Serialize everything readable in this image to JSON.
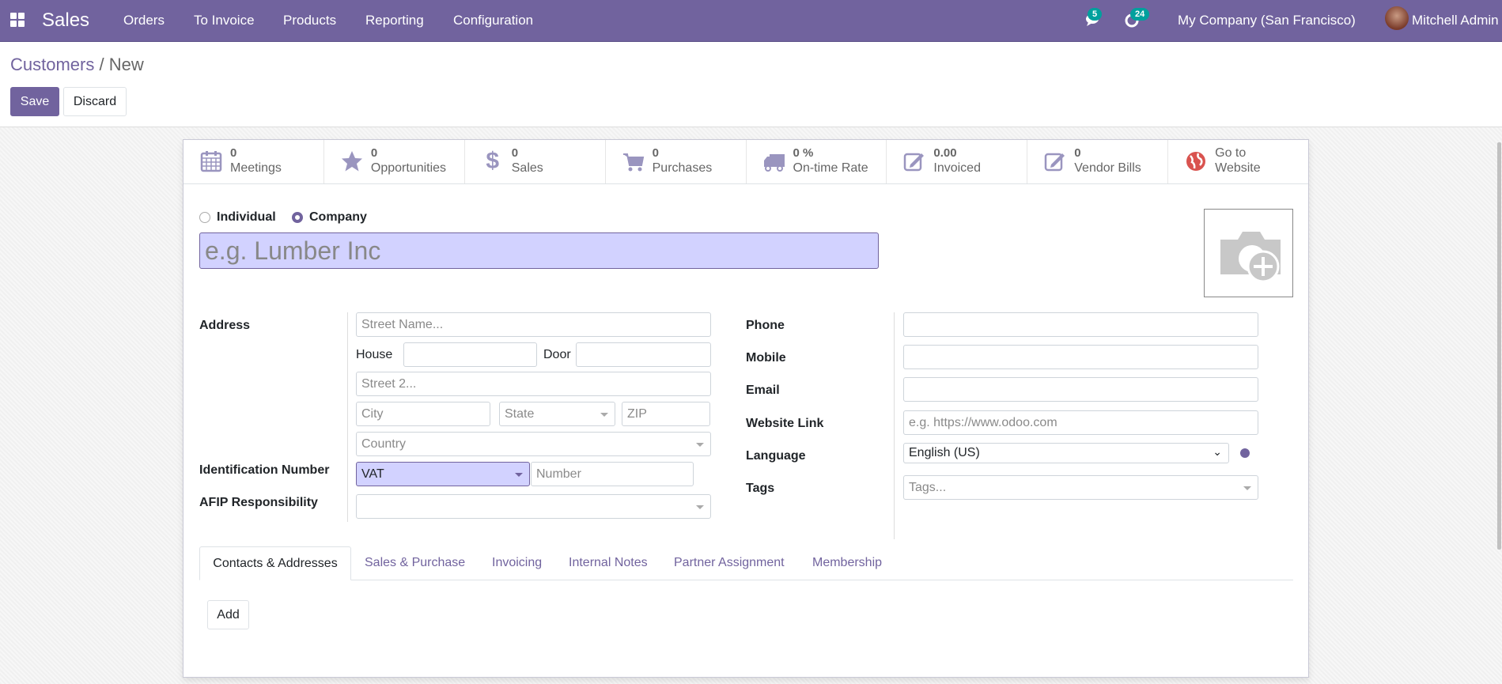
{
  "navbar": {
    "app": "Sales",
    "menu": [
      "Orders",
      "To Invoice",
      "Products",
      "Reporting",
      "Configuration"
    ],
    "messages_count": "5",
    "activities_count": "24",
    "company": "My Company (San Francisco)",
    "user": "Mitchell Admin"
  },
  "breadcrumb": {
    "parent": "Customers",
    "sep": "/",
    "current": "New"
  },
  "actions": {
    "save": "Save",
    "discard": "Discard"
  },
  "smart_buttons": [
    {
      "value": "0",
      "label": "Meetings",
      "icon": "calendar-icon"
    },
    {
      "value": "0",
      "label": "Opportunities",
      "icon": "star-icon"
    },
    {
      "value": "0",
      "label": "Sales",
      "icon": "dollar-icon"
    },
    {
      "value": "0",
      "label": "Purchases",
      "icon": "cart-icon"
    },
    {
      "value": "0 %",
      "label": "On-time Rate",
      "icon": "truck-icon"
    },
    {
      "value": "0.00",
      "label": "Invoiced",
      "icon": "edit-icon"
    },
    {
      "value": "0",
      "label": "Vendor Bills",
      "icon": "edit-icon"
    },
    {
      "value": "Go to",
      "label": "Website",
      "icon": "globe-icon"
    }
  ],
  "form": {
    "type_individual": "Individual",
    "type_company": "Company",
    "selected_type": "Company",
    "name_placeholder": "e.g. Lumber Inc",
    "address_label": "Address",
    "street_placeholder": "Street Name...",
    "house_label": "House",
    "door_label": "Door",
    "street2_placeholder": "Street 2...",
    "city_placeholder": "City",
    "state_placeholder": "State",
    "zip_placeholder": "ZIP",
    "country_placeholder": "Country",
    "id_number_label": "Identification Number",
    "id_type": "VAT",
    "id_number_placeholder": "Number",
    "afip_label": "AFIP Responsibility",
    "phone_label": "Phone",
    "mobile_label": "Mobile",
    "email_label": "Email",
    "website_label": "Website Link",
    "website_placeholder": "e.g. https://www.odoo.com",
    "language_label": "Language",
    "language_value": "English (US)",
    "tags_label": "Tags",
    "tags_placeholder": "Tags..."
  },
  "tabs": [
    "Contacts & Addresses",
    "Sales & Purchase",
    "Invoicing",
    "Internal Notes",
    "Partner Assignment",
    "Membership"
  ],
  "active_tab": "Contacts & Addresses",
  "tab_content": {
    "add": "Add"
  },
  "colors": {
    "brand": "#71639e",
    "badge": "#00a09d",
    "highlight": "#d2d2ff"
  }
}
